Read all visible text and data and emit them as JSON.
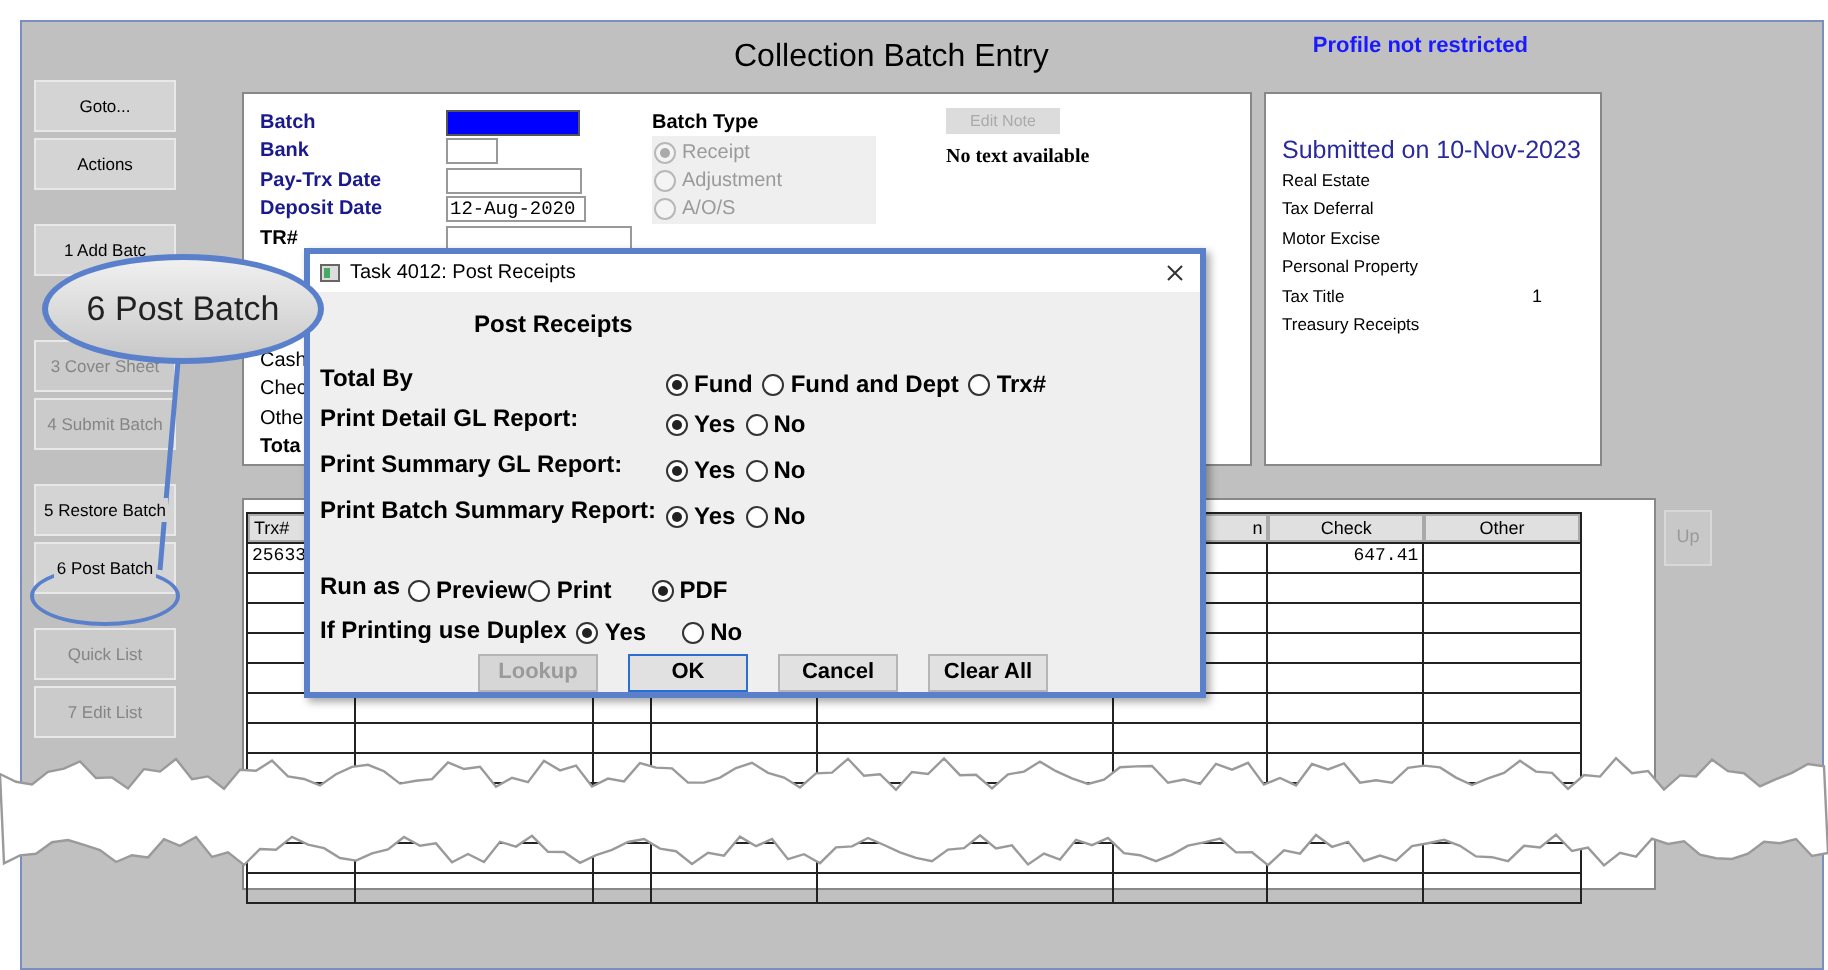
{
  "window": {
    "title": "Collection Batch Entry",
    "profile_status": "Profile not restricted"
  },
  "sidebar": {
    "groups": [
      [
        {
          "label": "Goto...",
          "disabled": false
        },
        {
          "label": "Actions",
          "disabled": false
        }
      ],
      [
        {
          "label": "1 Add Batc",
          "disabled": false
        },
        {
          "label": "3 Cover Sheet",
          "disabled": true
        },
        {
          "label": "4 Submit Batch",
          "disabled": true
        }
      ],
      [
        {
          "label": "5 Restore Batch",
          "disabled": false
        },
        {
          "label": "6 Post Batch",
          "disabled": false,
          "circled": true
        }
      ],
      [
        {
          "label": "Quick List",
          "disabled": true
        },
        {
          "label": "7 Edit List",
          "disabled": true
        }
      ]
    ]
  },
  "batch_form": {
    "fields": [
      {
        "label": "Batch",
        "required": true,
        "focused": true
      },
      {
        "label": "Bank",
        "required": true,
        "focused": false
      },
      {
        "label": "Pay-Trx Date",
        "required": true,
        "focused": false
      },
      {
        "label": "Deposit Date",
        "required": true,
        "focused": false,
        "value": "12-Aug-2020"
      },
      {
        "label": "TR#",
        "required": false,
        "focused": false
      }
    ],
    "batch_type": {
      "label": "Batch Type",
      "options": [
        {
          "label": "Receipt",
          "selected": true,
          "disabled": true
        },
        {
          "label": "Adjustment",
          "selected": false,
          "disabled": true
        },
        {
          "label": "A/O/S",
          "selected": false,
          "disabled": true
        }
      ]
    },
    "edit_note_button": {
      "label": "Edit Note",
      "disabled": true
    },
    "note_text": "No text available",
    "totals_labels": [
      "Cash",
      "Chec",
      "Othe",
      "Tota"
    ]
  },
  "summary": {
    "title": "Submitted on 10-Nov-2023",
    "items": [
      {
        "label": "Real Estate"
      },
      {
        "label": "Tax Deferral"
      },
      {
        "label": "Motor Excise"
      },
      {
        "label": "Personal Property"
      },
      {
        "label": "Tax Title",
        "count": "1"
      },
      {
        "label": "Treasury Receipts"
      }
    ]
  },
  "table": {
    "columns": [
      "Trx#",
      "n",
      "Check",
      "Other"
    ],
    "rows": [
      {
        "trx": "25633",
        "check": "647.41"
      }
    ]
  },
  "up_button": {
    "label": "Up",
    "disabled": true
  },
  "dialog": {
    "title": "Task 4012: Post Receipts",
    "heading": "Post Receipts",
    "options": [
      {
        "label": "Total By",
        "choices": [
          {
            "label": "Fund",
            "selected": true
          },
          {
            "label": "Fund and Dept",
            "selected": false
          },
          {
            "label": "Trx#",
            "selected": false
          }
        ]
      },
      {
        "label": "Print Detail GL Report:",
        "choices": [
          {
            "label": "Yes",
            "selected": true
          },
          {
            "label": "No",
            "selected": false
          }
        ]
      },
      {
        "label": "Print Summary GL Report:",
        "choices": [
          {
            "label": "Yes",
            "selected": true
          },
          {
            "label": "No",
            "selected": false
          }
        ]
      },
      {
        "label": "Print Batch Summary Report:",
        "choices": [
          {
            "label": "Yes",
            "selected": true
          },
          {
            "label": "No",
            "selected": false
          }
        ]
      }
    ],
    "run_as": {
      "label": "Run as",
      "choices": [
        {
          "label": "Preview",
          "selected": false
        },
        {
          "label": "Print",
          "selected": false
        },
        {
          "label": "PDF",
          "selected": true
        }
      ]
    },
    "duplex": {
      "label": "If Printing use Duplex",
      "choices": [
        {
          "label": "Yes",
          "selected": true
        },
        {
          "label": "No",
          "selected": false
        }
      ]
    },
    "buttons": [
      {
        "label": "Lookup",
        "disabled": true,
        "default": false
      },
      {
        "label": "OK",
        "disabled": false,
        "default": true
      },
      {
        "label": "Cancel",
        "disabled": false,
        "default": false
      },
      {
        "label": "Clear All",
        "disabled": false,
        "default": false
      }
    ]
  },
  "callout": {
    "text": "6 Post Batch"
  }
}
